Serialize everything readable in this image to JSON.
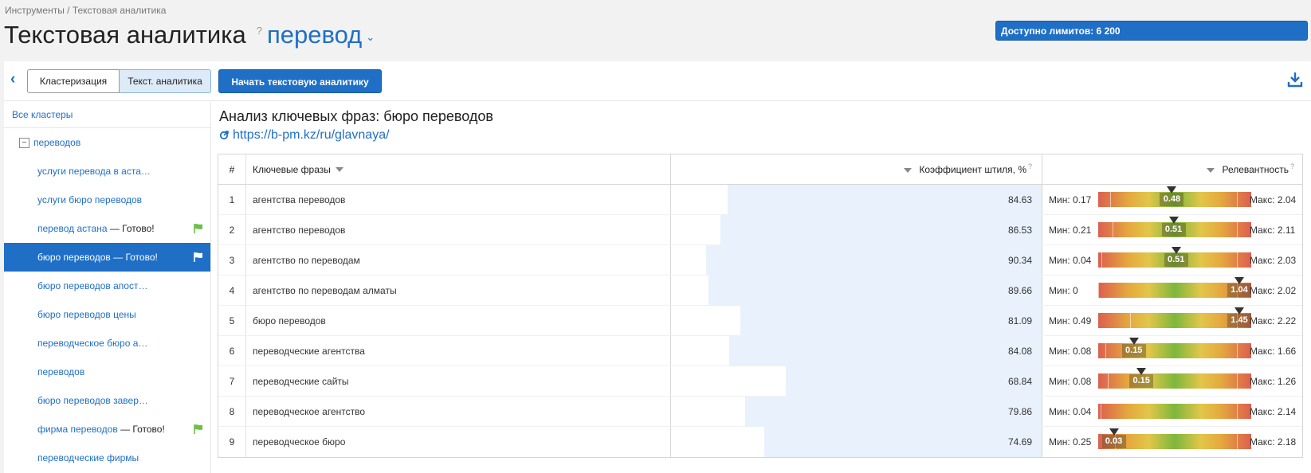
{
  "breadcrumb": "Инструменты / Текстовая аналитика",
  "page_title": "Текстовая аналитика",
  "help_mark": "?",
  "project": "перевод",
  "limits": "Доступно лимитов: 6 200",
  "toolbar": {
    "tab_clustering": "Кластеризация",
    "tab_text": "Текст. аналитика",
    "start_button": "Начать текстовую аналитику"
  },
  "sidebar": {
    "all_clusters": "Все кластеры",
    "root": "переводов",
    "items": [
      {
        "label": "услуги перевода в аста…",
        "done": ""
      },
      {
        "label": "услуги бюро переводов",
        "done": ""
      },
      {
        "label": "перевод астана",
        "done": " — Готово!"
      },
      {
        "label": "бюро переводов",
        "done": " — Готово!"
      },
      {
        "label": "бюро переводов апост…",
        "done": ""
      },
      {
        "label": "бюро переводов цены",
        "done": ""
      },
      {
        "label": "переводческое бюро а…",
        "done": ""
      },
      {
        "label": "переводов",
        "done": ""
      },
      {
        "label": "бюро переводов завер…",
        "done": ""
      },
      {
        "label": "фирма переводов",
        "done": " — Готово!"
      },
      {
        "label": "переводческие фирмы",
        "done": ""
      }
    ]
  },
  "analysis": {
    "title": "Анализ ключевых фраз: бюро переводов",
    "url": "https://b-pm.kz/ru/glavnaya/"
  },
  "table": {
    "headers": {
      "num": "#",
      "phrase": "Ключевые фразы",
      "coef": "Коэффициент штиля, %",
      "coef_help": "?",
      "rel": "Релевантность",
      "rel_help": "?"
    },
    "rows": [
      {
        "n": "1",
        "phrase": "агентства переводов",
        "coef": "84.63",
        "coef_fill": 0.8463,
        "min": "Мин: 0.17",
        "max": "Макс: 2.04",
        "val": "0.48",
        "min_v": 0.17,
        "max_v": 2.04,
        "v": 0.48
      },
      {
        "n": "2",
        "phrase": "агентство переводов",
        "coef": "86.53",
        "coef_fill": 0.8653,
        "min": "Мин: 0.21",
        "max": "Макс: 2.11",
        "val": "0.51",
        "min_v": 0.21,
        "max_v": 2.11,
        "v": 0.51
      },
      {
        "n": "3",
        "phrase": "агентство по переводам",
        "coef": "90.34",
        "coef_fill": 0.9034,
        "min": "Мин: 0.04",
        "max": "Макс: 2.03",
        "val": "0.51",
        "min_v": 0.04,
        "max_v": 2.03,
        "v": 0.51
      },
      {
        "n": "4",
        "phrase": "агентство по переводам алматы",
        "coef": "89.66",
        "coef_fill": 0.8966,
        "min": "Мин: 0",
        "max": "Макс: 2.02",
        "val": "1.04",
        "min_v": 0,
        "max_v": 2.02,
        "v": 1.04
      },
      {
        "n": "5",
        "phrase": "бюро переводов",
        "coef": "81.09",
        "coef_fill": 0.8109,
        "min": "Мин: 0.49",
        "max": "Макс: 2.22",
        "val": "1.45",
        "min_v": 0.49,
        "max_v": 2.22,
        "v": 1.45
      },
      {
        "n": "6",
        "phrase": "переводческие агентства",
        "coef": "84.08",
        "coef_fill": 0.8408,
        "min": "Мин: 0.08",
        "max": "Макс: 1.66",
        "val": "0.15",
        "min_v": 0.08,
        "max_v": 1.66,
        "v": 0.15
      },
      {
        "n": "7",
        "phrase": "переводческие сайты",
        "coef": "68.84",
        "coef_fill": 0.6884,
        "min": "Мин: 0.08",
        "max": "Макс: 1.26",
        "val": "0.15",
        "min_v": 0.08,
        "max_v": 1.26,
        "v": 0.15
      },
      {
        "n": "8",
        "phrase": "переводческое агентство",
        "coef": "79.86",
        "coef_fill": 0.7986,
        "min": "Мин: 0.04",
        "max": "Макс: 2.14",
        "val": "",
        "min_v": 0.04,
        "max_v": 2.14,
        "v": null
      },
      {
        "n": "9",
        "phrase": "переводческое бюро",
        "coef": "74.69",
        "coef_fill": 0.7469,
        "min": "Мин: 0.25",
        "max": "Макс: 2.18",
        "val": "0.03",
        "min_v": 0.25,
        "max_v": 2.18,
        "v": 0.03
      }
    ]
  },
  "colors": {
    "accent": "#1f6fc7",
    "done_flag": "#6dbf4b"
  }
}
